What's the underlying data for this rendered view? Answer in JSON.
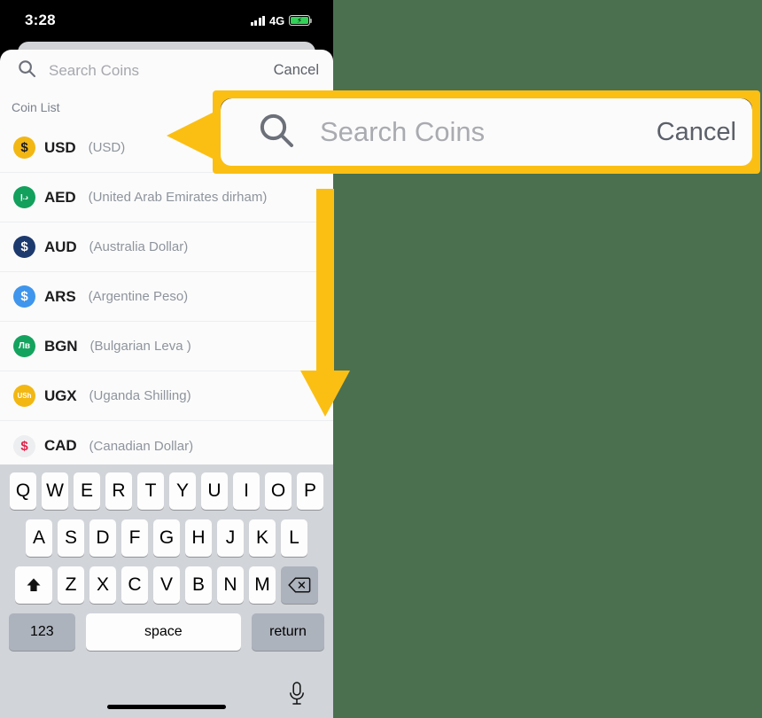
{
  "background_color": "#4a7050",
  "accent_color": "#fbbf14",
  "status_bar": {
    "time": "3:28",
    "network_type": "4G",
    "signal_icon": "signal-bars-icon",
    "battery_icon": "battery-charging-icon",
    "battery_charging": true
  },
  "search": {
    "icon": "search-icon",
    "value": "",
    "placeholder": "Search Coins",
    "cancel_label": "Cancel"
  },
  "coin_list": {
    "header": "Coin List",
    "items": [
      {
        "ticker": "USD",
        "name": "(USD)",
        "symbol": "$",
        "bg": "#f2b713",
        "fg": "#1c1c1e"
      },
      {
        "ticker": "AED",
        "name": "(United Arab Emirates dirham)",
        "symbol": "د.إ",
        "bg": "#12a05c",
        "fg": "#ffffff"
      },
      {
        "ticker": "AUD",
        "name": "(Australia Dollar)",
        "symbol": "$",
        "bg": "#1d3a6e",
        "fg": "#ffffff"
      },
      {
        "ticker": "ARS",
        "name": "(Argentine Peso)",
        "symbol": "$",
        "bg": "#3f96ec",
        "fg": "#ffffff"
      },
      {
        "ticker": "BGN",
        "name": "(Bulgarian Leva )",
        "symbol": "Лв",
        "bg": "#14a35e",
        "fg": "#ffffff"
      },
      {
        "ticker": "UGX",
        "name": "(Uganda Shilling)",
        "symbol": "USh",
        "bg": "#f2b713",
        "fg": "#ffffff"
      },
      {
        "ticker": "CAD",
        "name": "(Canadian Dollar)",
        "symbol": "$",
        "bg": "#eceef0",
        "fg": "#e0234a"
      }
    ]
  },
  "keyboard": {
    "row1": [
      "Q",
      "W",
      "E",
      "R",
      "T",
      "Y",
      "U",
      "I",
      "O",
      "P"
    ],
    "row2": [
      "A",
      "S",
      "D",
      "F",
      "G",
      "H",
      "J",
      "K",
      "L"
    ],
    "row3": [
      "Z",
      "X",
      "C",
      "V",
      "B",
      "N",
      "M"
    ],
    "shift_icon": "shift-up-arrow-icon",
    "backspace_icon": "backspace-delete-icon",
    "numbers_label": "123",
    "space_label": "space",
    "return_label": "return",
    "mic_icon": "microphone-icon",
    "home_indicator": "home-indicator"
  },
  "callout": {
    "icon": "search-icon",
    "placeholder": "Search Coins",
    "cancel_label": "Cancel",
    "pointer_icon": "left-pointer-triangle",
    "arrow_icon": "down-arrow"
  }
}
